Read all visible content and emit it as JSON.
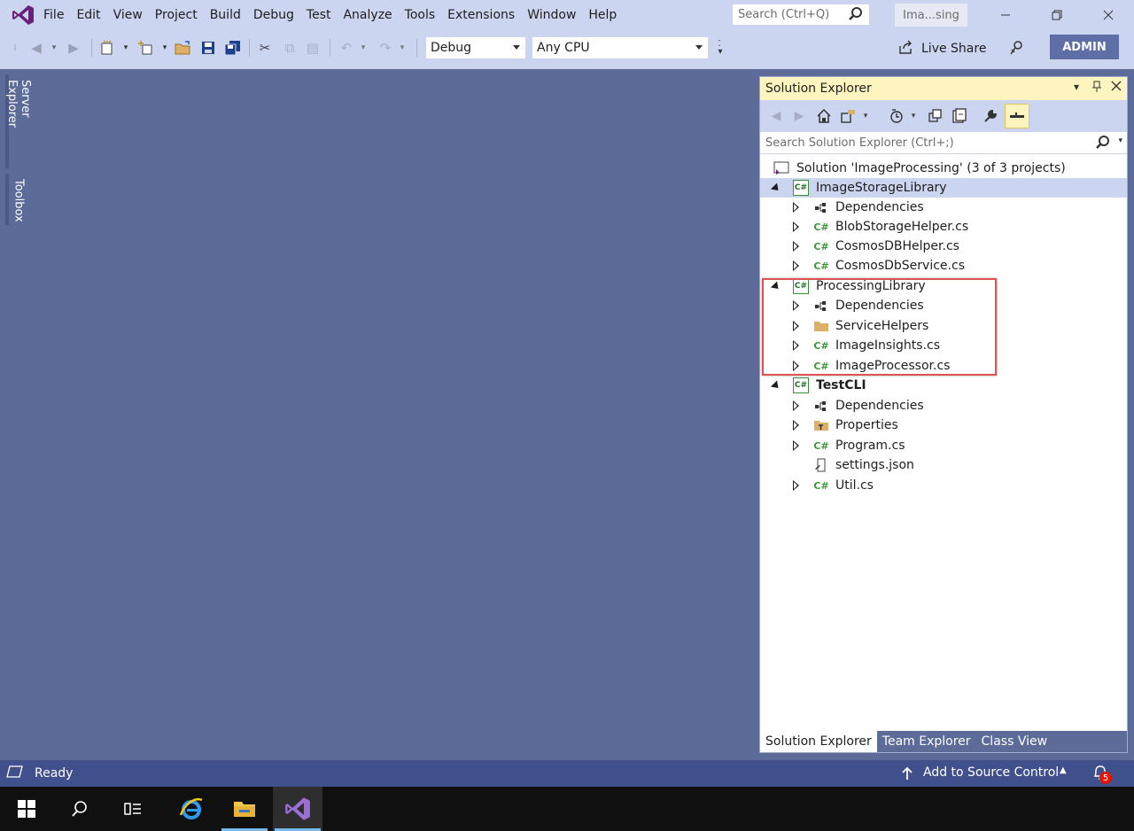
{
  "menubar": {
    "items": [
      "File",
      "Edit",
      "View",
      "Project",
      "Build",
      "Debug",
      "Test",
      "Analyze",
      "Tools",
      "Extensions",
      "Window",
      "Help"
    ],
    "search_placeholder": "Search (Ctrl+Q)",
    "solution_short": "Ima...sing"
  },
  "toolbar": {
    "config": "Debug",
    "platform": "Any CPU",
    "live_share": "Live Share",
    "admin": "ADMIN"
  },
  "left_rail": {
    "tabs": [
      "Server Explorer",
      "Toolbox"
    ]
  },
  "solution_explorer": {
    "title": "Solution Explorer",
    "search_placeholder": "Search Solution Explorer (Ctrl+;)",
    "solution_label": "Solution 'ImageProcessing' (3 of 3 projects)",
    "projects": [
      {
        "name": "ImageStorageLibrary",
        "items": [
          "Dependencies",
          "BlobStorageHelper.cs",
          "CosmosDBHelper.cs",
          "CosmosDbService.cs"
        ]
      },
      {
        "name": "ProcessingLibrary",
        "items": [
          "Dependencies",
          "ServiceHelpers",
          "ImageInsights.cs",
          "ImageProcessor.cs"
        ]
      },
      {
        "name": "TestCLI",
        "items": [
          "Dependencies",
          "Properties",
          "Program.cs",
          "settings.json",
          "Util.cs"
        ]
      }
    ],
    "bottom_tabs": [
      "Solution Explorer",
      "Team Explorer",
      "Class View"
    ]
  },
  "statusbar": {
    "status": "Ready",
    "source_control": "Add to Source Control",
    "notifications": "5"
  },
  "colors": {
    "accent": "#68217a",
    "background": "#5d6b99",
    "chrome": "#ccd5f0",
    "status": "#40508d",
    "highlight_box": "#e05252"
  }
}
